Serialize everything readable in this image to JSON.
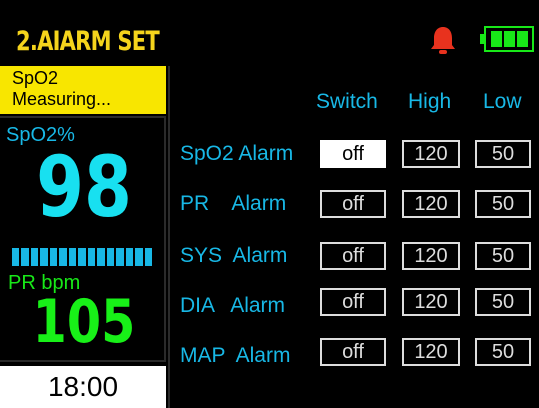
{
  "header": {
    "title": "2.AIARM SET",
    "bell_color": "#e8321e",
    "battery_color": "#18e818"
  },
  "sidebar": {
    "status_line1": "SpO2",
    "status_line2": "Measuring...",
    "spo2_label": "SpO2%",
    "spo2_value": "98",
    "pr_label": "PR bpm",
    "pr_value": "105",
    "time": "18:00"
  },
  "table": {
    "headers": {
      "switch": "Switch",
      "high": "High",
      "low": "Low"
    },
    "rows": [
      {
        "label": "SpO2 Alarm",
        "switch": "off",
        "high": "120",
        "low": "50",
        "selected": true
      },
      {
        "label": "PR    Alarm",
        "switch": "off",
        "high": "120",
        "low": "50"
      },
      {
        "label": "SYS  Alarm",
        "switch": "off",
        "high": "120",
        "low": "50"
      },
      {
        "label": "DIA   Alarm",
        "switch": "off",
        "high": "120",
        "low": "50"
      },
      {
        "label": "MAP  Alarm",
        "switch": "off",
        "high": "120",
        "low": "50"
      }
    ]
  }
}
